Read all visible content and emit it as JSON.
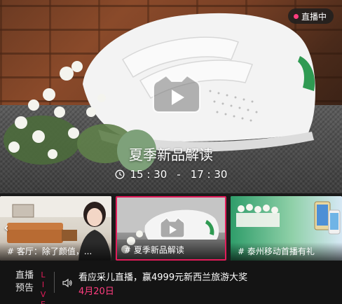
{
  "hero": {
    "badge_label": "直播中",
    "title": "夏季新品解读",
    "time_start": "15 : 30",
    "time_separator": "-",
    "time_end": "17 : 30"
  },
  "thumbnails": [
    {
      "caption": "# 客厅：除了颜值，..."
    },
    {
      "caption": "# 夏季新品解读"
    },
    {
      "caption": "# 泰州移动首播有礼"
    }
  ],
  "bottom_bar": {
    "preview_label_line1": "直播",
    "preview_label_line2": "预告",
    "live_vertical": "LIVE",
    "notice_text": "看应采儿直播，赢4999元新西兰旅游大奖",
    "notice_date": "4月20日"
  },
  "colors": {
    "accent": "#e21c5a",
    "live_dot": "#ff3d7f",
    "bar_background": "#141414"
  },
  "icons": [
    "play-icon",
    "clock-icon",
    "chevron-left-icon",
    "speaker-icon",
    "live-dot-icon"
  ]
}
